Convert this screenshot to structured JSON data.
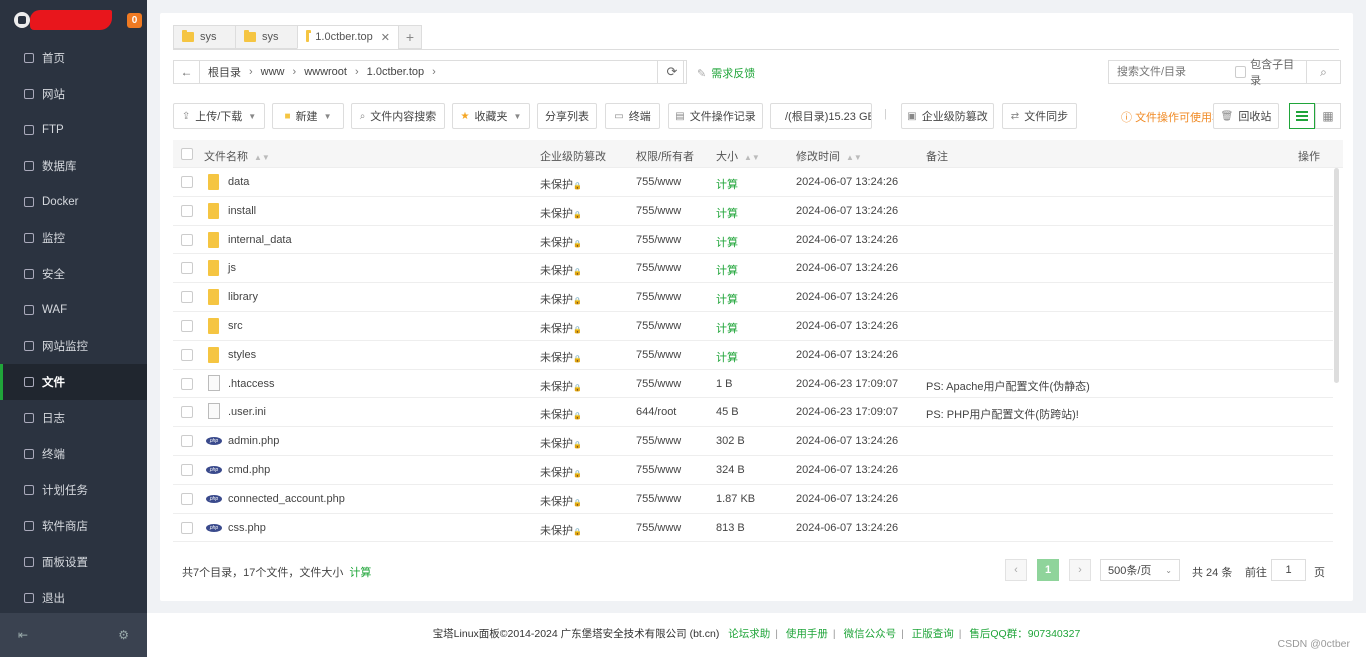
{
  "sidebar": {
    "badge": "0",
    "items": [
      {
        "label": "首页",
        "icon": "home-icon"
      },
      {
        "label": "网站",
        "icon": "globe-icon"
      },
      {
        "label": "FTP",
        "icon": "ftp-icon"
      },
      {
        "label": "数据库",
        "icon": "database-icon"
      },
      {
        "label": "Docker",
        "icon": "docker-icon"
      },
      {
        "label": "监控",
        "icon": "monitor-icon"
      },
      {
        "label": "安全",
        "icon": "shield-icon"
      },
      {
        "label": "WAF",
        "icon": "waf-icon"
      },
      {
        "label": "网站监控",
        "icon": "site-monitor-icon"
      },
      {
        "label": "文件",
        "icon": "folder-icon",
        "active": true
      },
      {
        "label": "日志",
        "icon": "log-icon"
      },
      {
        "label": "终端",
        "icon": "terminal-icon"
      },
      {
        "label": "计划任务",
        "icon": "schedule-icon"
      },
      {
        "label": "软件商店",
        "icon": "store-icon"
      },
      {
        "label": "面板设置",
        "icon": "settings-icon"
      },
      {
        "label": "退出",
        "icon": "logout-icon"
      }
    ]
  },
  "tabs": [
    "sys",
    "sys",
    "1.0ctber.top"
  ],
  "breadcrumb": [
    "根目录",
    "www",
    "wwwroot",
    "1.0ctber.top"
  ],
  "feedback": "需求反馈",
  "search": {
    "placeholder": "搜索文件/目录",
    "sub_label": "包含子目录"
  },
  "toolbar": {
    "upload": "上传/下载",
    "new": "新建",
    "content_search": "文件内容搜索",
    "favorites": "收藏夹",
    "share_list": "分享列表",
    "terminal": "终端",
    "op_log": "文件操作记录",
    "disk": "/(根目录)15.23 GB",
    "tamper": "企业级防篡改",
    "sync": "文件同步",
    "tip": "文件操作可使用右键",
    "recycle": "回收站"
  },
  "columns": {
    "name": "文件名称",
    "protect": "企业级防篡改",
    "perm": "权限/所有者",
    "size": "大小",
    "mtime": "修改时间",
    "note": "备注",
    "ops": "操作"
  },
  "files": [
    {
      "type": "folder",
      "name": "data",
      "protect": "未保护",
      "perm": "755/www",
      "size": "计算",
      "mtime": "2024-06-07 13:24:26",
      "note": ""
    },
    {
      "type": "folder",
      "name": "install",
      "protect": "未保护",
      "perm": "755/www",
      "size": "计算",
      "mtime": "2024-06-07 13:24:26",
      "note": ""
    },
    {
      "type": "folder",
      "name": "internal_data",
      "protect": "未保护",
      "perm": "755/www",
      "size": "计算",
      "mtime": "2024-06-07 13:24:26",
      "note": ""
    },
    {
      "type": "folder",
      "name": "js",
      "protect": "未保护",
      "perm": "755/www",
      "size": "计算",
      "mtime": "2024-06-07 13:24:26",
      "note": ""
    },
    {
      "type": "folder",
      "name": "library",
      "protect": "未保护",
      "perm": "755/www",
      "size": "计算",
      "mtime": "2024-06-07 13:24:26",
      "note": ""
    },
    {
      "type": "folder",
      "name": "src",
      "protect": "未保护",
      "perm": "755/www",
      "size": "计算",
      "mtime": "2024-06-07 13:24:26",
      "note": ""
    },
    {
      "type": "folder",
      "name": "styles",
      "protect": "未保护",
      "perm": "755/www",
      "size": "计算",
      "mtime": "2024-06-07 13:24:26",
      "note": ""
    },
    {
      "type": "file",
      "name": ".htaccess",
      "protect": "未保护",
      "perm": "755/www",
      "size": "1 B",
      "mtime": "2024-06-23 17:09:07",
      "note": "PS: Apache用户配置文件(伪静态)"
    },
    {
      "type": "file",
      "name": ".user.ini",
      "protect": "未保护",
      "perm": "644/root",
      "size": "45 B",
      "mtime": "2024-06-23 17:09:07",
      "note": "PS: PHP用户配置文件(防跨站)!"
    },
    {
      "type": "php",
      "name": "admin.php",
      "protect": "未保护",
      "perm": "755/www",
      "size": "302 B",
      "mtime": "2024-06-07 13:24:26",
      "note": ""
    },
    {
      "type": "php",
      "name": "cmd.php",
      "protect": "未保护",
      "perm": "755/www",
      "size": "324 B",
      "mtime": "2024-06-07 13:24:26",
      "note": ""
    },
    {
      "type": "php",
      "name": "connected_account.php",
      "protect": "未保护",
      "perm": "755/www",
      "size": "1.87 KB",
      "mtime": "2024-06-07 13:24:26",
      "note": ""
    },
    {
      "type": "php",
      "name": "css.php",
      "protect": "未保护",
      "perm": "755/www",
      "size": "813 B",
      "mtime": "2024-06-07 13:24:26",
      "note": ""
    }
  ],
  "summary": {
    "text": "共7个目录，17个文件，文件大小",
    "calc": "计算"
  },
  "pager": {
    "current": "1",
    "page_size": "500条/页",
    "total": "共 24 条",
    "goto": "前往",
    "page": "1",
    "page_unit": "页"
  },
  "footer": {
    "copyright": "宝塔Linux面板©2014-2024 广东堡塔安全技术有限公司 (bt.cn)",
    "links": [
      "论坛求助",
      "使用手册",
      "微信公众号",
      "正版查询",
      "售后QQ群：907340327"
    ]
  },
  "watermark": "CSDN @0ctber",
  "colors": {
    "accent": "#20a53a",
    "sidebar_bg": "#2b3340",
    "warn": "#f08a24"
  }
}
